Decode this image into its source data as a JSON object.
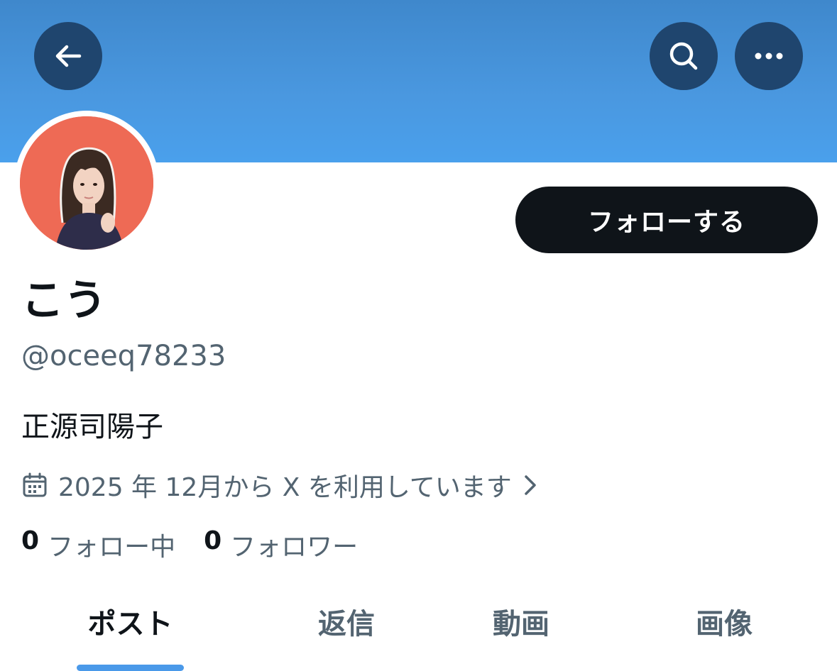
{
  "header": {
    "banner_color": "#4a98e0",
    "back_icon": "arrow-left-icon",
    "search_icon": "search-icon",
    "more_icon": "more-horizontal-icon"
  },
  "profile": {
    "display_name": "こう",
    "handle": "@oceeq78233",
    "bio": "正源司陽子",
    "joined_text": "2025 年 12月から X を利用しています",
    "avatar_bg": "#ee6a55"
  },
  "actions": {
    "follow_label": "フォローする"
  },
  "stats": {
    "following_count": "0",
    "following_label": "フォロー中",
    "followers_count": "0",
    "followers_label": "フォロワー"
  },
  "tabs": [
    {
      "label": "ポスト",
      "active": true
    },
    {
      "label": "返信",
      "active": false
    },
    {
      "label": "動画",
      "active": false
    },
    {
      "label": "画像",
      "active": false
    }
  ]
}
